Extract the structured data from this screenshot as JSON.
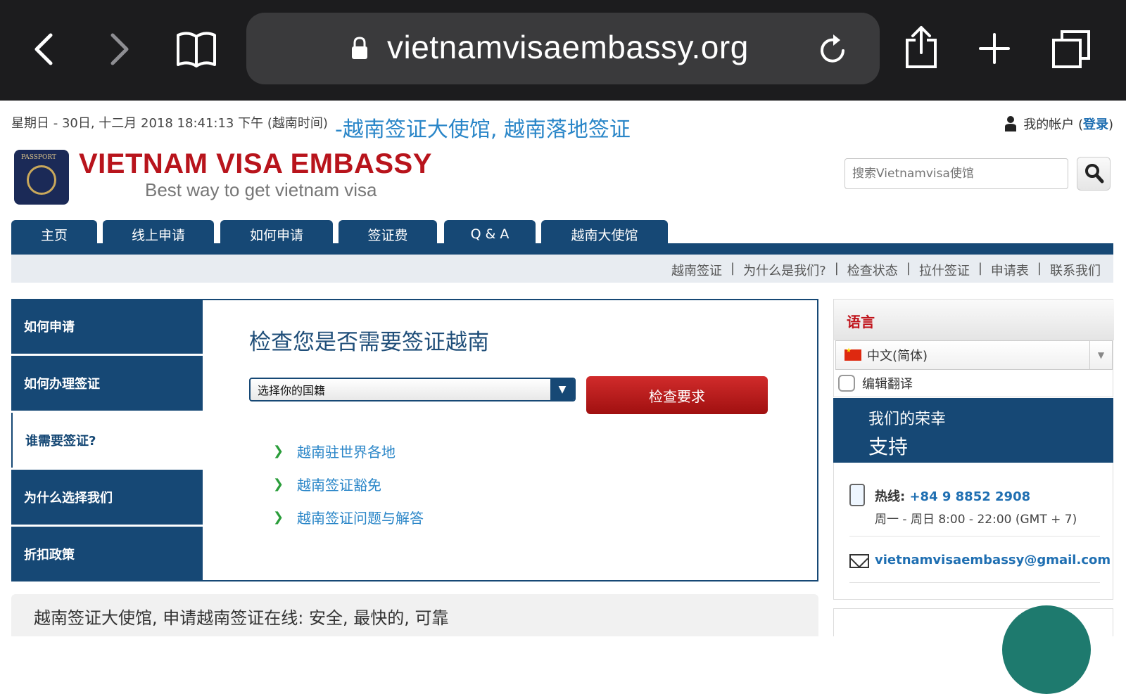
{
  "browser": {
    "url": "vietnamvisaembassy.org",
    "icons": [
      "back-icon",
      "forward-icon",
      "bookmarks-icon",
      "lock-icon",
      "reload-icon",
      "share-icon",
      "new-tab-icon",
      "tabs-icon"
    ]
  },
  "header": {
    "date_line": "星期日 - 30日, 十二月 2018 18:41:13 下午 (越南时间)",
    "site_title": "-越南签证大使馆, 越南落地签证",
    "account_label": "我的帐户 (",
    "login_label": "登录",
    "account_close": ")",
    "logo_passport": "PASSPORT",
    "logo_main": "VIETNAM VISA EMBASSY",
    "logo_sub": "Best way to get vietnam visa",
    "search_placeholder": "搜索Vietnamvisa使馆"
  },
  "nav": {
    "tabs": [
      "主页",
      "线上申请",
      "如何申请",
      "签证费",
      "Q & A",
      "越南大使馆"
    ]
  },
  "subnav": {
    "items": [
      "越南签证",
      "|",
      "为什么是我们?",
      "|",
      "检查状态",
      "|",
      "拉什签证",
      "|",
      "申请表",
      "|",
      "联系我们"
    ]
  },
  "left_menu": {
    "items": [
      "如何申请",
      "如何办理签证",
      "谁需要签证?",
      "为什么选择我们",
      "折扣政策"
    ]
  },
  "content": {
    "title": "检查您是否需要签证越南",
    "select_value": "选择你的国籍",
    "check_button": "检查要求",
    "links": [
      "越南驻世界各地",
      "越南签证豁免",
      "越南签证问题与解答"
    ]
  },
  "sidebar": {
    "lang_title": "语言",
    "lang_value": "中文(简体)",
    "edit_translate": "编辑翻译",
    "honor_1": "我们的荣幸",
    "honor_2": "支持",
    "hotline_label": "热线: ",
    "hotline_number": "+84 9 8852 2908",
    "hours": "周一 - 周日 8:00 - 22:00 (GMT + 7)",
    "email": "vietnamvisaembassy@gmail.com"
  },
  "footer": {
    "bottom_text": "越南签证大使馆, 申请越南签证在线: 安全, 最快的, 可靠"
  },
  "colors": {
    "nav_blue": "#164875",
    "link_blue": "#2a86c8",
    "red": "#b8141c"
  }
}
